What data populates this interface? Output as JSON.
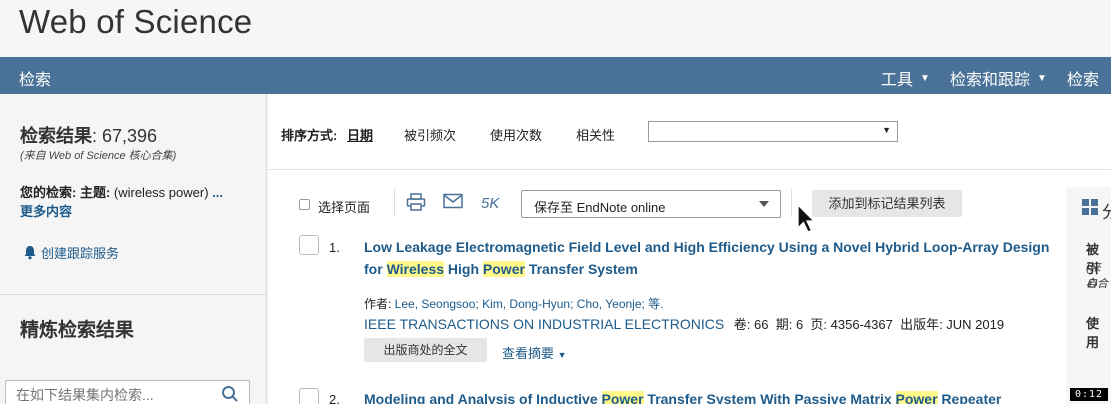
{
  "app": {
    "brand": "Web of Science"
  },
  "nav": {
    "search": "检索",
    "tools": "工具",
    "search_track": "检索和跟踪",
    "history": "检索历"
  },
  "sidebar": {
    "results_label": "检索结果",
    "results_count": ": 67,396",
    "results_source": "(来自 Web of Science 核心合集)",
    "your_search_label": "您的检索: 主题:",
    "your_search_value": " (wireless power) ",
    "more_dots": "...",
    "more": "更多内容",
    "create_alert": "创建跟踪服务",
    "refine_title": "精炼检索结果",
    "refine_placeholder": "在如下结果集内检索..."
  },
  "sort": {
    "label": "排序方式:",
    "options": [
      "日期",
      "被引频次",
      "使用次数",
      "相关性"
    ],
    "active": "日期",
    "select_value": ""
  },
  "toolbar": {
    "select_page": "选择页面",
    "five_k": "5K",
    "endnote": "保存至 EndNote online",
    "add_marked": "添加到标记结果列表"
  },
  "records": [
    {
      "num": "1.",
      "title_parts": [
        "Low Leakage Electromagnetic Field Level and High Efficiency Using a Novel Hybrid Loop-Array Design for ",
        "Wireless",
        " High ",
        "Power",
        " Transfer System"
      ],
      "authors_label": "作者: ",
      "authors": "Lee, Seongsoo; Kim, Dong-Hyun; Cho, Yeonje; 等.",
      "journal": "IEEE TRANSACTIONS ON INDUSTRIAL ELECTRONICS",
      "vol": "卷: 66",
      "issue": "期: 6",
      "pages": "页: 4356-4367",
      "pub_date": "出版年: JUN 2019",
      "fulltext": "出版商处的全文",
      "abstract": "查看摘要"
    },
    {
      "num": "2.",
      "title_parts": [
        "Modeling and Analysis of Inductive ",
        "Power",
        " Transfer System With Passive Matrix ",
        "Power",
        " Repeater"
      ]
    }
  ],
  "right_panel": {
    "chars": [
      "分",
      "被引",
      "(来自",
      "心合",
      "使用"
    ]
  },
  "timer": "0:12",
  "colors": {
    "nav": "#4a7298",
    "link": "#1e5b8a",
    "highlight": "#fff98a"
  }
}
